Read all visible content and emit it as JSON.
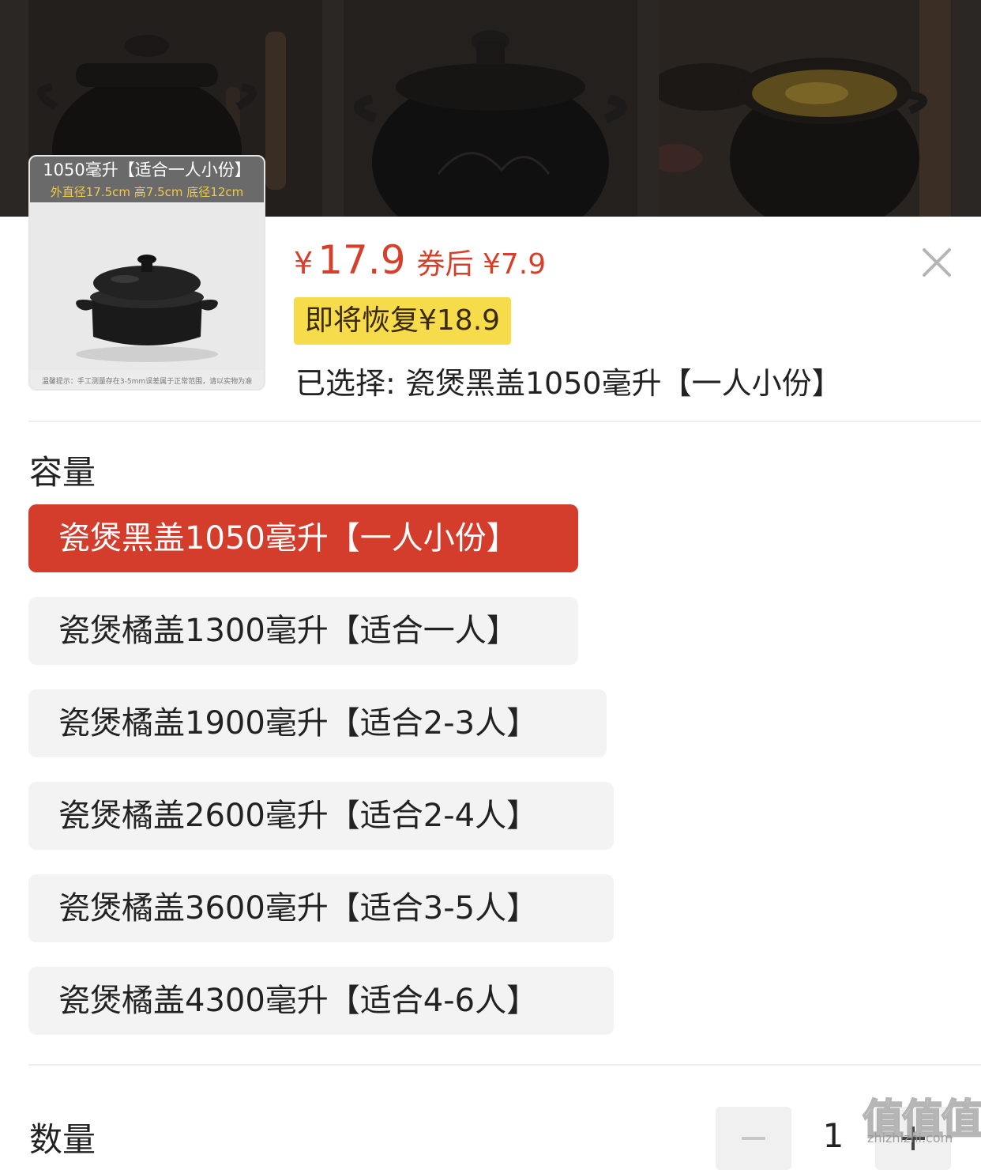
{
  "gallery": {
    "photos": [
      "clay-pot-photo-1",
      "clay-pot-photo-2",
      "clay-pot-photo-3"
    ]
  },
  "thumbnail": {
    "caption_title": "1050毫升【适合一人小份】",
    "caption_dims": "外直径17.5cm 高7.5cm 底径12cm",
    "note": "温馨提示：手工测量存在3-5mm误差属于正常范围，请以实物为准"
  },
  "price": {
    "currency": "¥",
    "amount": "17.9",
    "after_coupon": "券后 ¥7.9",
    "restore_notice": "即将恢复¥18.9",
    "accent_color": "#d6402b"
  },
  "selection": {
    "selected_text": "已选择: 瓷煲黑盖1050毫升【一人小份】"
  },
  "capacity": {
    "title": "容量",
    "options": [
      {
        "label": "瓷煲黑盖1050毫升【一人小份】",
        "selected": true
      },
      {
        "label": "瓷煲橘盖1300毫升【适合一人】",
        "selected": false
      },
      {
        "label": "瓷煲橘盖1900毫升【适合2-3人】",
        "selected": false
      },
      {
        "label": "瓷煲橘盖2600毫升【适合2-4人】",
        "selected": false
      },
      {
        "label": "瓷煲橘盖3600毫升【适合3-5人】",
        "selected": false
      },
      {
        "label": "瓷煲橘盖4300毫升【适合4-6人】",
        "selected": false
      }
    ]
  },
  "quantity": {
    "title": "数量",
    "value": "1"
  },
  "watermark": {
    "main": "值值值",
    "sub": "zhizhizhi.com"
  },
  "icons": {
    "close": "close-icon",
    "minus": "minus-icon",
    "plus": "plus-icon"
  }
}
